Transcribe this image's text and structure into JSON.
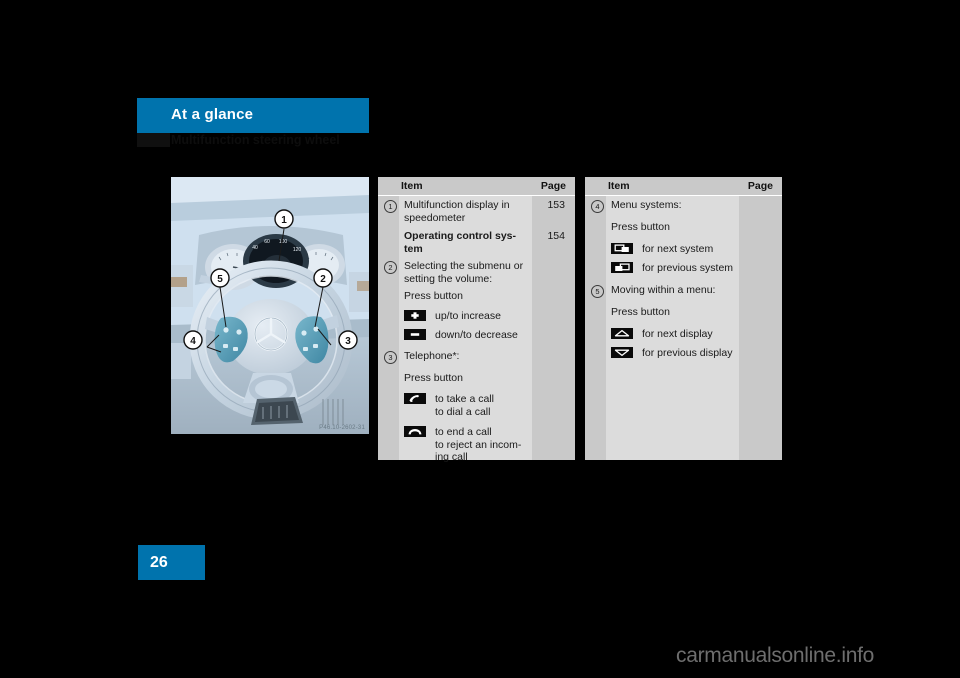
{
  "chapter": {
    "title": "At a glance",
    "subtitle": "Multifunction steering wheel"
  },
  "page": {
    "number": "26",
    "watermark": "carmanualsonline.info"
  },
  "figure": {
    "name": "multifunction-steering-wheel-illustration",
    "image_code": "P46.10-2602-31",
    "callouts": [
      "1",
      "2",
      "3",
      "4",
      "5"
    ]
  },
  "tables": [
    {
      "id": "left",
      "headers": {
        "item": "Item",
        "page": "Page"
      },
      "rows": [
        {
          "num": "1",
          "lines": [
            "Multifunction display in",
            "speedometer"
          ],
          "page": "153",
          "bold": false
        },
        {
          "num": "",
          "lines": [
            "Operating control sys-",
            "tem"
          ],
          "page": "154",
          "bold": true
        },
        {
          "num": "2",
          "lines": [
            "Selecting the submenu or",
            "setting the volume:"
          ],
          "page": "",
          "bold": false
        },
        {
          "num": "",
          "lines": [
            "Press button"
          ],
          "page": "",
          "bold": false
        },
        {
          "num": "",
          "icon": "plus-button-icon",
          "lines": [
            "up/to increase"
          ],
          "page": ""
        },
        {
          "num": "",
          "icon": "minus-button-icon",
          "lines": [
            "down/to decrease"
          ],
          "page": ""
        },
        {
          "num": "3",
          "lines": [
            "Telephone*:"
          ],
          "page": "",
          "bold": false
        },
        {
          "num": "",
          "lines": [
            "Press button"
          ],
          "page": "",
          "bold": false
        },
        {
          "num": "",
          "icon": "take-call-icon",
          "lines": [
            "to take a call",
            "to dial a call"
          ],
          "page": ""
        },
        {
          "num": "",
          "icon": "end-call-icon",
          "lines": [
            "to end a call",
            "to reject an incom-",
            "ing call"
          ],
          "page": ""
        }
      ]
    },
    {
      "id": "right",
      "headers": {
        "item": "Item",
        "page": "Page"
      },
      "rows": [
        {
          "num": "4",
          "lines": [
            "Menu systems:"
          ],
          "page": "",
          "bold": false
        },
        {
          "num": "",
          "lines": [
            "Press button"
          ],
          "page": "",
          "bold": false
        },
        {
          "num": "",
          "icon": "next-system-icon",
          "lines": [
            "for next system"
          ],
          "page": ""
        },
        {
          "num": "",
          "icon": "previous-system-icon",
          "lines": [
            "for previous system"
          ],
          "page": ""
        },
        {
          "num": "5",
          "lines": [
            "Moving within a menu:"
          ],
          "page": "",
          "bold": false
        },
        {
          "num": "",
          "lines": [
            "Press button"
          ],
          "page": "",
          "bold": false
        },
        {
          "num": "",
          "icon": "next-display-icon",
          "lines": [
            "for next display"
          ],
          "page": ""
        },
        {
          "num": "",
          "icon": "previous-display-icon",
          "lines": [
            "for previous display"
          ],
          "page": ""
        }
      ]
    }
  ],
  "colors": {
    "accent_blue": "#0073ad",
    "table_gray": "#c9c9c9",
    "content_gray": "#dcdcdc",
    "figure_sky": "#cfe0ef",
    "icon_black": "#0a0a0a"
  }
}
